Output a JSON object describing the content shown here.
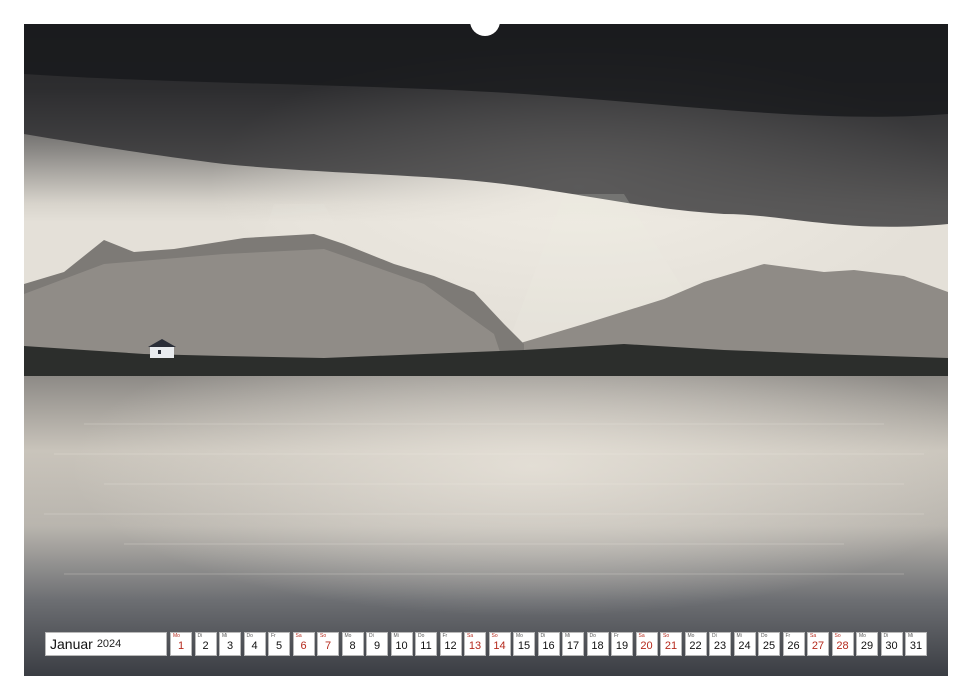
{
  "calendar": {
    "month": "Januar",
    "year": "2024",
    "days": [
      {
        "wd": "Mo",
        "num": "1",
        "red": true
      },
      {
        "wd": "Di",
        "num": "2",
        "red": false
      },
      {
        "wd": "Mi",
        "num": "3",
        "red": false
      },
      {
        "wd": "Do",
        "num": "4",
        "red": false
      },
      {
        "wd": "Fr",
        "num": "5",
        "red": false
      },
      {
        "wd": "Sa",
        "num": "6",
        "red": true
      },
      {
        "wd": "So",
        "num": "7",
        "red": true
      },
      {
        "wd": "Mo",
        "num": "8",
        "red": false
      },
      {
        "wd": "Di",
        "num": "9",
        "red": false
      },
      {
        "wd": "Mi",
        "num": "10",
        "red": false
      },
      {
        "wd": "Do",
        "num": "11",
        "red": false
      },
      {
        "wd": "Fr",
        "num": "12",
        "red": false
      },
      {
        "wd": "Sa",
        "num": "13",
        "red": true
      },
      {
        "wd": "So",
        "num": "14",
        "red": true
      },
      {
        "wd": "Mo",
        "num": "15",
        "red": false
      },
      {
        "wd": "Di",
        "num": "16",
        "red": false
      },
      {
        "wd": "Mi",
        "num": "17",
        "red": false
      },
      {
        "wd": "Do",
        "num": "18",
        "red": false
      },
      {
        "wd": "Fr",
        "num": "19",
        "red": false
      },
      {
        "wd": "Sa",
        "num": "20",
        "red": true
      },
      {
        "wd": "So",
        "num": "21",
        "red": true
      },
      {
        "wd": "Mo",
        "num": "22",
        "red": false
      },
      {
        "wd": "Di",
        "num": "23",
        "red": false
      },
      {
        "wd": "Mi",
        "num": "24",
        "red": false
      },
      {
        "wd": "Do",
        "num": "25",
        "red": false
      },
      {
        "wd": "Fr",
        "num": "26",
        "red": false
      },
      {
        "wd": "Sa",
        "num": "27",
        "red": true
      },
      {
        "wd": "So",
        "num": "28",
        "red": true
      },
      {
        "wd": "Mo",
        "num": "29",
        "red": false
      },
      {
        "wd": "Di",
        "num": "30",
        "red": false
      },
      {
        "wd": "Mi",
        "num": "31",
        "red": false
      }
    ]
  },
  "colors": {
    "weekend_red": "#b5291c",
    "binding_dot": "#2a2a2a"
  }
}
